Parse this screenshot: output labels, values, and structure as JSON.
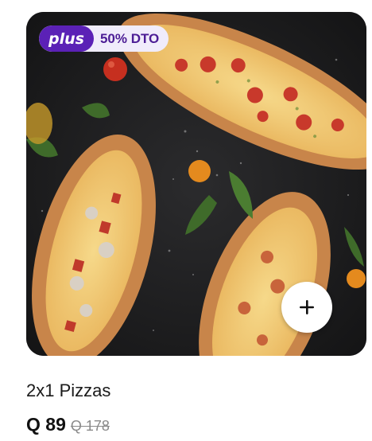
{
  "product": {
    "name": "2x1 Pizzas",
    "price_current": "Q 89",
    "price_old": "Q 178",
    "image_alt": "pide-pizzas-image"
  },
  "badge": {
    "plus_label": "plus",
    "discount_label": "50% DTO"
  },
  "actions": {
    "add_icon": "plus-icon"
  },
  "colors": {
    "plus_brand": "#5b21b6",
    "discount_text": "#4c1d95",
    "badge_bg": "#f0ecfb"
  }
}
